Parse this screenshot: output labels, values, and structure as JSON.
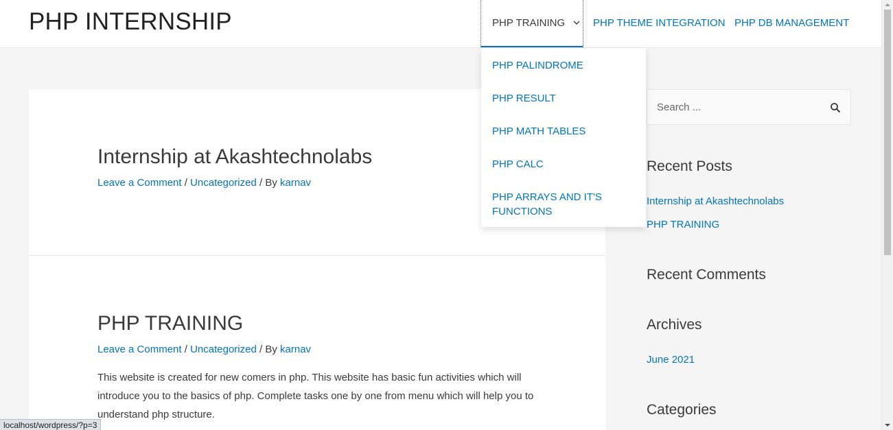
{
  "header": {
    "site_title": "PHP INTERNSHIP",
    "nav": {
      "training": "PHP TRAINING",
      "theme_integration": "PHP THEME INTEGRATION",
      "db_management": "PHP DB MANAGEMENT"
    }
  },
  "dropdown": {
    "items": [
      "PHP PALINDROME",
      "PHP RESULT",
      "PHP MATH TABLES",
      "PHP CALC",
      "PHP ARRAYS AND IT'S FUNCTIONS"
    ]
  },
  "posts": [
    {
      "title": "Internship at Akashtechnolabs",
      "comment_link": "Leave a Comment",
      "category": "Uncategorized",
      "by": "By",
      "author": "karnav"
    },
    {
      "title": "PHP TRAINING",
      "comment_link": "Leave a Comment",
      "category": "Uncategorized",
      "by": "By",
      "author": "karnav",
      "excerpt": "This website is created for new comers in php. This website has basic fun activities which will introduce you to the basics of php. Complete tasks one by one from menu which will help you to understand php structure."
    }
  ],
  "sidebar": {
    "search_placeholder": "Search ...",
    "recent_posts_title": "Recent Posts",
    "recent_posts": [
      "Internship at Akashtechnolabs",
      "PHP TRAINING"
    ],
    "recent_comments_title": "Recent Comments",
    "archives_title": "Archives",
    "archives": [
      "June 2021"
    ],
    "categories_title": "Categories"
  },
  "status_bar": {
    "url": "localhost/wordpress/?p=3"
  },
  "colors": {
    "link": "#0274be",
    "text": "#3a3a3a",
    "background": "#f5f5f5"
  }
}
